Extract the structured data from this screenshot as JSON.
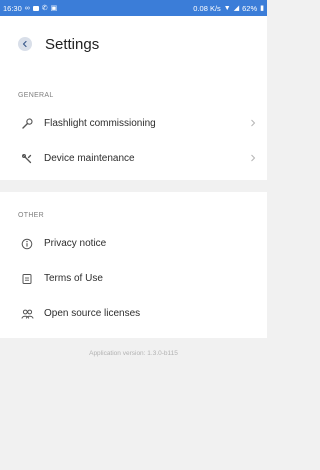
{
  "status_bar": {
    "time": "16:30",
    "network_speed": "0.08 K/s",
    "battery": "62%"
  },
  "header": {
    "title": "Settings"
  },
  "general": {
    "heading": "GENERAL",
    "items": [
      {
        "label": "Flashlight commissioning",
        "icon": "wrench-icon"
      },
      {
        "label": "Device maintenance",
        "icon": "tools-icon"
      }
    ]
  },
  "other": {
    "heading": "OTHER",
    "items": [
      {
        "label": "Privacy notice",
        "icon": "info-icon"
      },
      {
        "label": "Terms of Use",
        "icon": "document-icon"
      },
      {
        "label": "Open source licenses",
        "icon": "people-icon"
      }
    ]
  },
  "footer": {
    "version": "Application version: 1.3.0-b115"
  },
  "colors": {
    "status_bar": "#3b7dd8",
    "page_background": "#f1f1f1",
    "card_background": "#ffffff",
    "back_button": "#d9dfe9"
  }
}
